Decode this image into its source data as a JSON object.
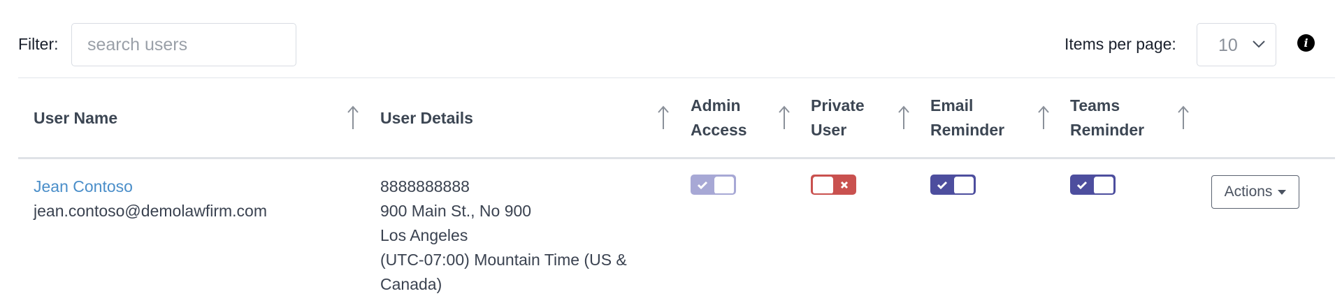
{
  "filter": {
    "label": "Filter:",
    "placeholder": "search users",
    "value": ""
  },
  "pagination": {
    "label": "Items per page:",
    "value": "10"
  },
  "colors": {
    "link": "#4a8ec9",
    "toggle_on": "#4d4e9e",
    "toggle_disabled": "#a7a8d5",
    "toggle_off": "#c9514f"
  },
  "table": {
    "headers": {
      "user_name": "User Name",
      "user_details": "User Details",
      "admin_access": [
        "Admin",
        "Access"
      ],
      "private_user": [
        "Private",
        "User"
      ],
      "email_reminder": [
        "Email",
        "Reminder"
      ],
      "teams_reminder": [
        "Teams",
        "Reminder"
      ]
    },
    "rows": [
      {
        "name": "Jean Contoso",
        "email": "jean.contoso@demolawfirm.com",
        "details": [
          "8888888888",
          "900 Main St., No 900",
          "Los Angeles",
          "(UTC-07:00) Mountain Time (US &",
          "Canada)"
        ],
        "admin_access": {
          "on": true,
          "disabled": true
        },
        "private_user": {
          "on": false
        },
        "email_reminder": {
          "on": true
        },
        "teams_reminder": {
          "on": true
        },
        "actions_label": "Actions"
      }
    ]
  }
}
